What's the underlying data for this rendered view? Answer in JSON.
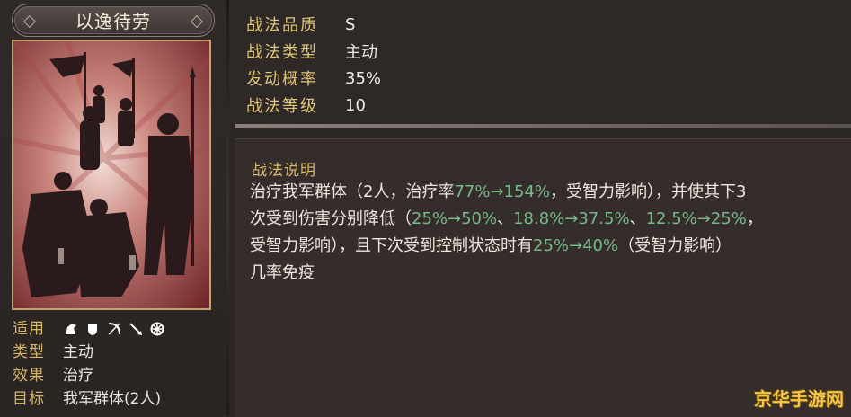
{
  "skill": {
    "name": "以逸待劳"
  },
  "stats": [
    {
      "label": "战法品质",
      "value": "S"
    },
    {
      "label": "战法类型",
      "value": "主动"
    },
    {
      "label": "发动概率",
      "value": "35%"
    },
    {
      "label": "战法等级",
      "value": "10"
    }
  ],
  "meta": {
    "applicable_label": "适用",
    "applicable_icons": [
      "cavalry-icon",
      "shield-icon",
      "bow-icon",
      "spear-icon",
      "wheel-icon"
    ],
    "type_label": "类型",
    "type_value": "主动",
    "effect_label": "效果",
    "effect_value": "治疗",
    "target_label": "目标",
    "target_value": "我军群体(2人)"
  },
  "description": {
    "title": "战法说明",
    "line1_a": "治疗我军群体（2人，治疗率",
    "line1_hl": "77%→154%",
    "line1_b": "，受智力影响），并使其下3",
    "line2_a": "次受到伤害分别降低（",
    "line2_hl1": "25%→50%",
    "line2_sep1": "、",
    "line2_hl2": "18.8%→37.5%",
    "line2_sep2": "、",
    "line2_hl3": "12.5%→25%",
    "line2_b": "，",
    "line3_a": "受智力影响），且下次受到控制状态时有",
    "line3_hl": "25%→40%",
    "line3_b": "（受智力影响）",
    "line4": "几率免疫"
  },
  "watermark": "京华手游网",
  "colors": {
    "gold_label": "#d6b766",
    "highlight_green": "#78b98a",
    "card_red": "#8a2e2e"
  }
}
